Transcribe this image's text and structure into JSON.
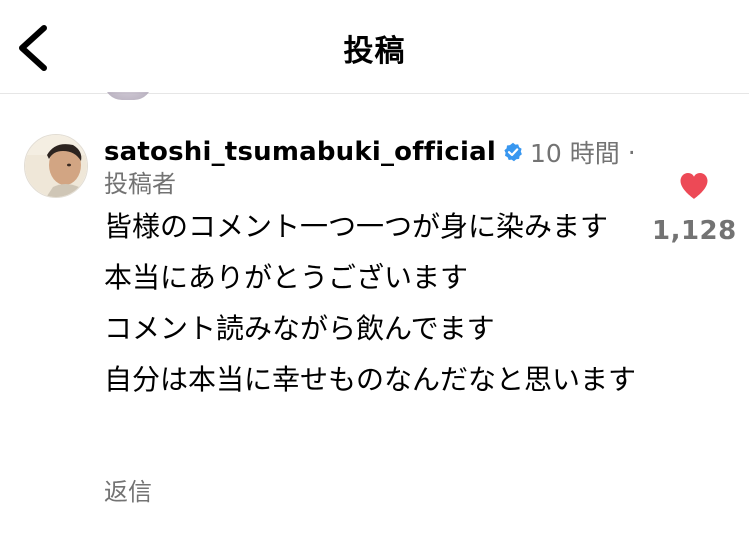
{
  "header": {
    "title": "投稿",
    "back_icon": "chevron-left-icon"
  },
  "comment": {
    "username": "satoshi_tsumabuki_official",
    "verified_icon": "verified-badge-icon",
    "time": "10 時間",
    "separator": "·",
    "role": "投稿者",
    "paragraphs": [
      "皆様のコメント一つ一つが身に染みます",
      "本当にありがとうございます",
      "コメント読みながら飲んでます",
      "自分は本当に幸せものなんだなと思います"
    ],
    "reply_label": "返信",
    "like_icon": "heart-icon",
    "like_count": "1,128"
  },
  "colors": {
    "text": "#000000",
    "secondary": "#737373",
    "like": "#ed4956",
    "verified": "#3897f0"
  }
}
